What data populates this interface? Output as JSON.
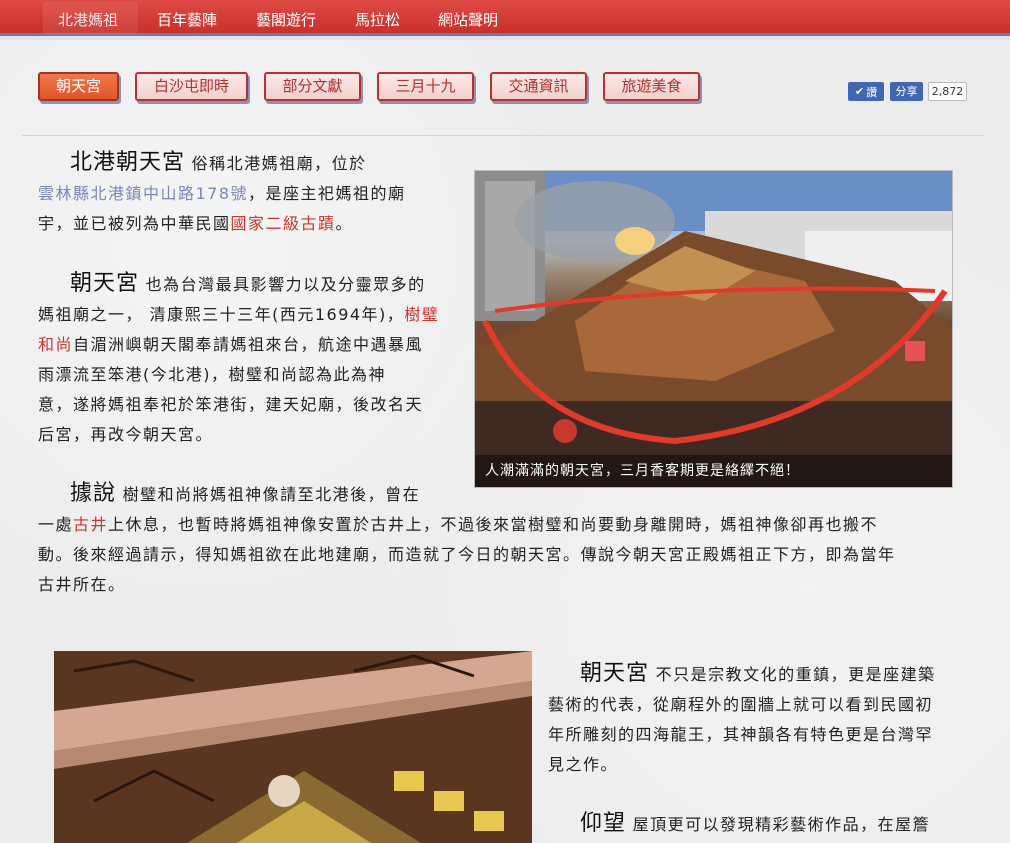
{
  "topnav": {
    "items": [
      "北港媽祖",
      "百年藝陣",
      "藝閣遊行",
      "馬拉松",
      "網站聲明"
    ]
  },
  "tabs": [
    "朝天宮",
    "白沙屯即時",
    "部分文獻",
    "三月十九",
    "交通資訊",
    "旅遊美食"
  ],
  "share": {
    "like_label": "讚",
    "share_label": "分享",
    "count": "2,872"
  },
  "colors": {
    "nav_red": "#d13c37",
    "tab_active": "#e8602f",
    "link_blue": "#7b87b8",
    "link_red": "#c8382f"
  },
  "photo1": {
    "caption": "人潮滿滿的朝天宮，三月香客期更是絡繹不絕！"
  },
  "p1": {
    "title": "北港朝天宮",
    "t1": "俗稱北港媽祖廟，位於",
    "link": "雲林縣北港鎮中山路178號",
    "t2": "，是座主祀媽祖的廟",
    "t3": "宇，並已被列為中華民國",
    "link2": "國家二級古蹟",
    "t4": "。"
  },
  "p2": {
    "title": "朝天宮",
    "t1": "也為台灣最具影響力以及分靈眾多的",
    "t2": "媽祖廟之一， 清康熙三十三年(西元1694年)，",
    "link": "樹璧",
    "link2": "和尚",
    "t3": "自湄洲嶼朝天閣奉請媽祖來台，航途中遇暴風",
    "t4": "雨漂流至笨港(今北港)，樹璧和尚認為此為神",
    "t5": "意，遂將媽祖奉祀於笨港街，建天妃廟，後改名天",
    "t6": "后宮，再改今朝天宮。"
  },
  "p3": {
    "title": "據說",
    "t1": "樹璧和尚將媽祖神像請至北港後，曾在",
    "t2a": "一處",
    "link": "古井",
    "t2b": "上休息，也暫時將媽祖神像安置於古井上，不過後來當樹璧和尚要動身離開時，媽祖神像卻再也搬不",
    "t3": "動。後來經過請示，得知媽祖欲在此地建廟，而造就了今日的朝天宮。傳說今朝天宮正殿媽祖正下方，即為當年",
    "t4": "古井所在。"
  },
  "p4": {
    "title": "朝天宮",
    "t1": "不只是宗教文化的重鎮，更是座建築",
    "t2": "藝術的代表，從廟程外的圍牆上就可以看到民國初",
    "t3": "年所雕刻的四海龍王，其神韻各有特色更是台灣罕",
    "t4": "見之作。"
  },
  "p5": {
    "title": "仰望",
    "t1": "屋頂更可以發現精彩藝術作品，在屋簷"
  }
}
